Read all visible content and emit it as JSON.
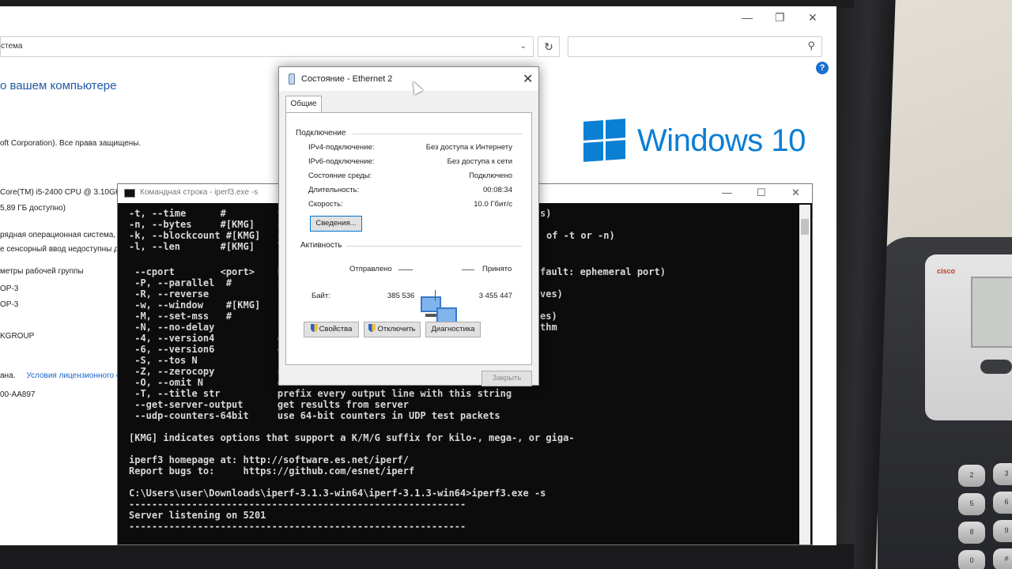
{
  "system_window": {
    "address_text": "стема",
    "heading": "о вашем компьютере",
    "copyright": "oft Corporation). Все права защищены.",
    "cpu": "Core(TM) i5-2400 CPU @ 3.10GH",
    "ram": "5,89 ГБ доступно)",
    "os_type": "рядная операционная система, п",
    "touch": "е сенсорный ввод недоступны д",
    "workgroup_params": "метры рабочей группы",
    "computer_name": "OP-3",
    "full_name": "OP-3",
    "workgroup": "KGROUP",
    "activation": "ана.",
    "license_link": "Условия лицензионного сог",
    "product_id": "00-AA897"
  },
  "win10_logo_text": "Windows 10",
  "cmd": {
    "title": "Командная строка - iperf3.exe  -s",
    "lines": [
      "-t, --time      #         ti",
      "-n, --bytes     #[KMG]    nu",
      "-k, --blockcount #[KMG]   nu",
      "-l, --len       #[KMG]    le",
      "                          (d",
      " --cport        <port>    bi",
      " -P, --parallel  #        nu",
      " -R, --reverse            ru",
      " -w, --window    #[KMG]   se",
      " -M, --set-mss   #        se",
      " -N, --no-delay           se",
      " -4, --version4           on",
      " -6, --version6           on",
      " -S, --tos N              se",
      " -Z, --zerocopy           us",
      " -O, --omit N             om",
      " -T, --title str          prefix every output line with this string",
      " --get-server-output      get results from server",
      " --udp-counters-64bit     use 64-bit counters in UDP test packets",
      "",
      "[KMG] indicates options that support a K/M/G suffix for kilo-, mega-, or giga-",
      "",
      "iperf3 homepage at: http://software.es.net/iperf/",
      "Report bugs to:     https://github.com/esnet/iperf",
      "",
      "C:\\Users\\user\\Downloads\\iperf-3.1.3-win64\\iperf-3.1.3-win64>iperf3.exe -s",
      "-----------------------------------------------------------",
      "Server listening on 5201",
      "-----------------------------------------------------------"
    ],
    "right_fragments": [
      {
        "line": 0,
        "text": "s)"
      },
      {
        "line": 2,
        "text": "of -t or -n)"
      },
      {
        "line": 5,
        "text": "fault: ephemeral port)"
      },
      {
        "line": 7,
        "text": "ves)"
      },
      {
        "line": 9,
        "text": "es)"
      },
      {
        "line": 10,
        "text": "thm"
      }
    ]
  },
  "dialog": {
    "title": "Состояние - Ethernet 2",
    "tab": "Общие",
    "connection_group": "Подключение",
    "rows": [
      {
        "key": "IPv4-подключение:",
        "value": "Без доступа к Интернету"
      },
      {
        "key": "IPv6-подключение:",
        "value": "Без доступа к сети"
      },
      {
        "key": "Состояние среды:",
        "value": "Подключено"
      },
      {
        "key": "Длительность:",
        "value": "00:08:34"
      },
      {
        "key": "Скорость:",
        "value": "10.0 Гбит/с"
      }
    ],
    "details_button": "Сведения...",
    "activity_group": "Активность",
    "sent_label": "Отправлено",
    "received_label": "Принято",
    "bytes_label": "Байт:",
    "bytes_sent": "385 536",
    "bytes_received": "3 455 447",
    "properties_button": "Свойства",
    "disable_button": "Отключить",
    "diagnose_button": "Диагностика",
    "close_button": "Закрыть"
  },
  "phone": {
    "brand": "cisco",
    "keys": [
      "2",
      "3",
      "5",
      "6",
      "8",
      "9",
      "0",
      "#"
    ]
  }
}
